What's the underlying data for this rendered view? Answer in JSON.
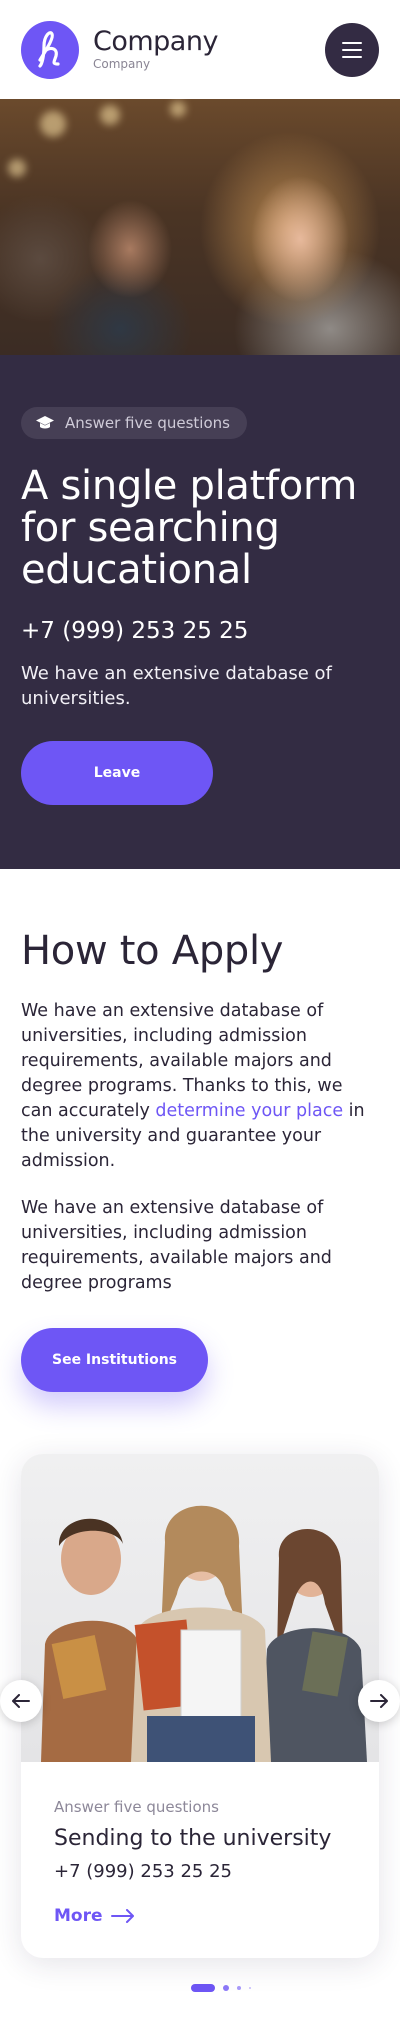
{
  "header": {
    "brand_name": "Company",
    "brand_sub": "Company",
    "logo_icon": "script-l-logo",
    "menu_icon": "hamburger-icon"
  },
  "hero": {
    "badge_icon": "graduation-cap-icon",
    "badge_text": "Answer five questions",
    "title": "A single platform for searching educational",
    "phone": "+7 (999) 253 25 25",
    "description": "We have an extensive database of universities.",
    "cta_label": "Leave"
  },
  "apply": {
    "title": "How to Apply",
    "paragraph1_before": "We have an extensive database of universities, including admission requirements, available majors and degree programs. Thanks to this, we can accurately ",
    "paragraph1_link": "determine your place",
    "paragraph1_after": " in the university and guarantee your admission.",
    "paragraph2": "We have an extensive database of universities, including admission requirements, available majors and degree programs",
    "cta_label": "See Institutions"
  },
  "carousel": {
    "active_index": 0,
    "slide_count": 4,
    "card": {
      "eyebrow": "Answer five questions",
      "title": "Sending to the university",
      "phone": "+7 (999) 253 25 25",
      "more_label": "More"
    }
  },
  "colors": {
    "accent": "#6e56f5",
    "hero_bg": "#332c43",
    "text_dark": "#2b2537"
  }
}
